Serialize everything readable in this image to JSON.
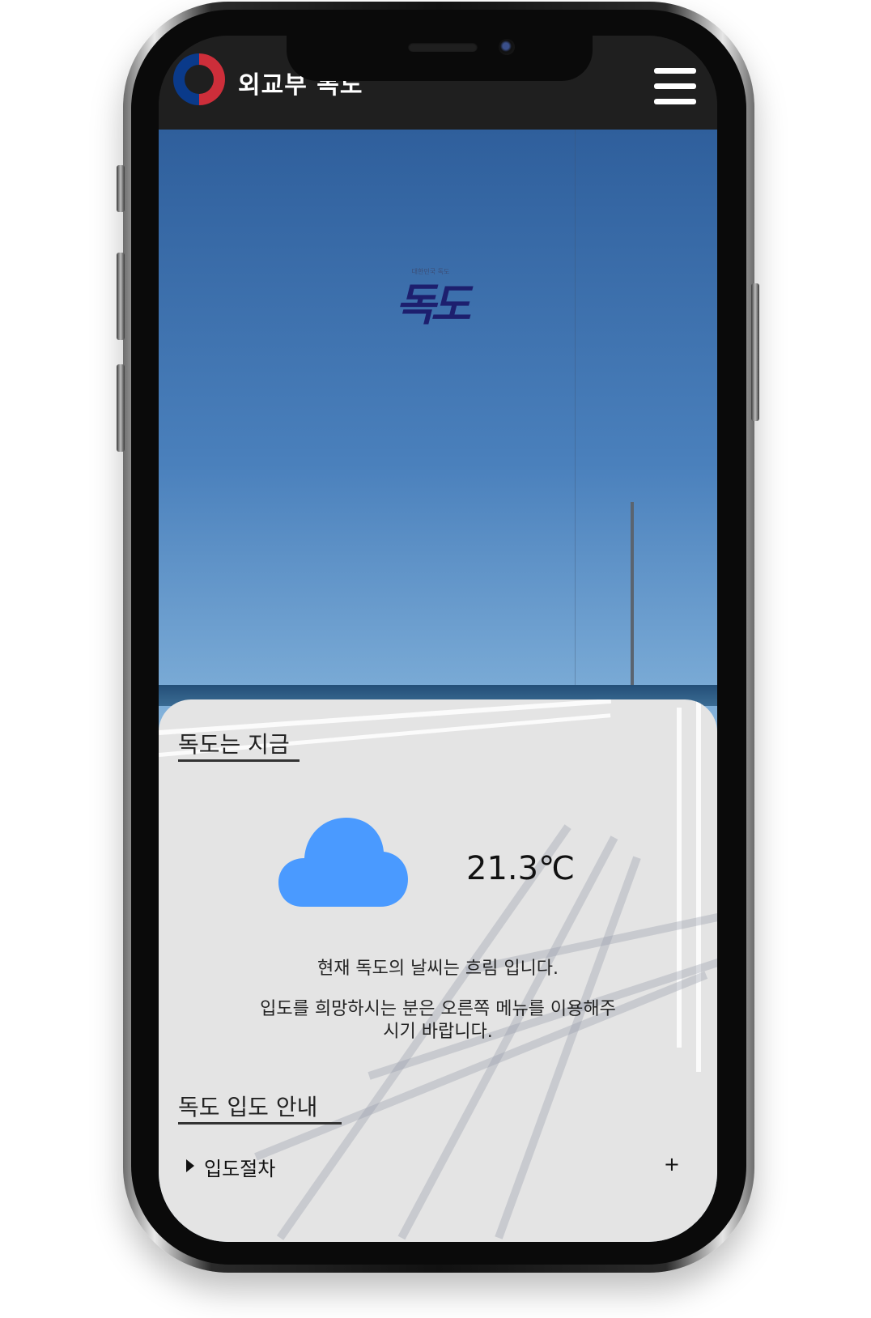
{
  "header": {
    "site_name": "외교부 독도",
    "logo_icon": "government-emblem-icon",
    "menu_icon": "hamburger-menu-icon"
  },
  "hero": {
    "calligraphy": "독도",
    "calligraphy_caption": "대한민국 독도"
  },
  "weather_section": {
    "title": "독도는 지금",
    "icon": "cloud-icon",
    "icon_color": "#4a9aff",
    "temperature": "21.3℃",
    "status_message": "현재 독도의 날씨는 흐림 입니다.",
    "guide_message_line1": "입도를 희망하시는 분은 오른쪽 메뉴를 이용해주",
    "guide_message_line2": "시기 바랍니다."
  },
  "landing_section": {
    "title": "독도 입도 안내",
    "items": [
      {
        "label": "입도절차",
        "expand_symbol": "+"
      }
    ]
  }
}
